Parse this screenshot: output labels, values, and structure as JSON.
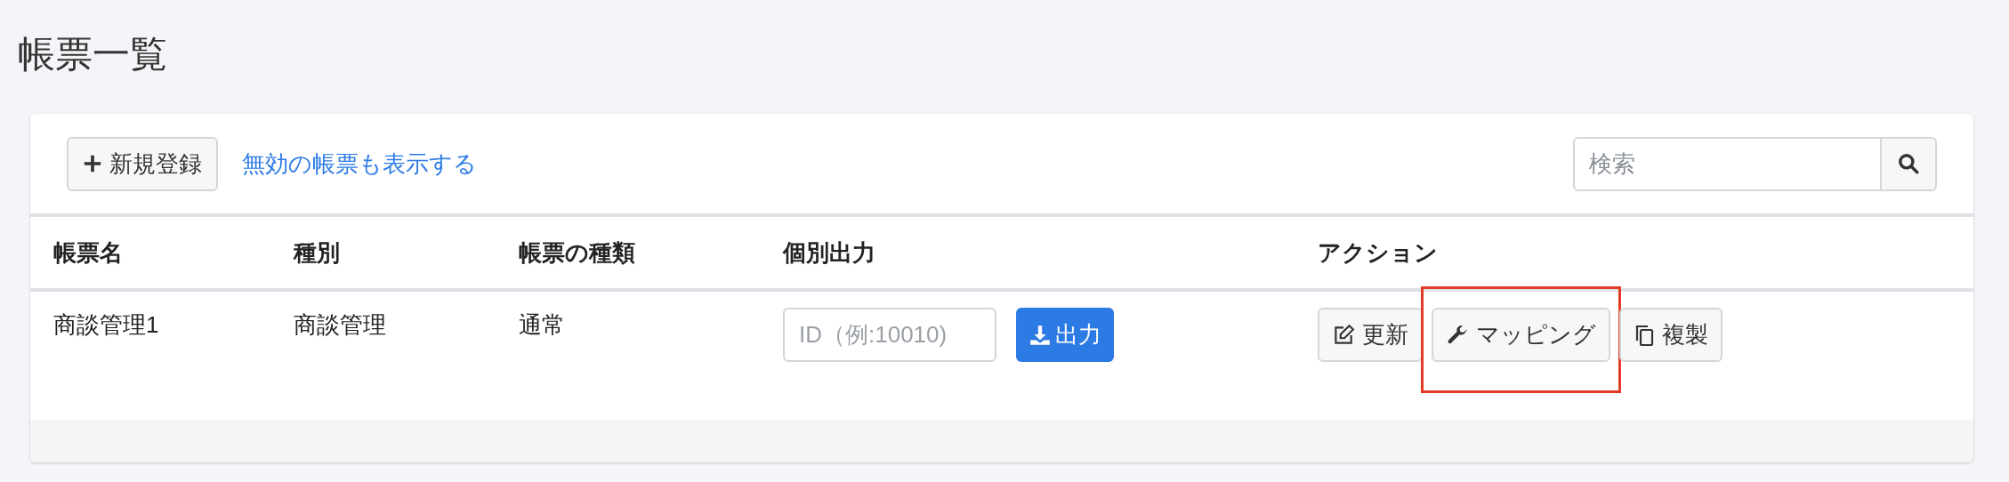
{
  "page_title": "帳票一覧",
  "toolbar": {
    "new_button": {
      "kind": "plus",
      "label": "新規登録"
    },
    "link": "無効の帳票も表示する",
    "search": {
      "placeholder": "検索"
    }
  },
  "table": {
    "columns": [
      "帳票名",
      "種別",
      "帳票の種類",
      "個別出力",
      "アクション"
    ],
    "rows": [
      {
        "name": "商談管理1",
        "type": "商談管理",
        "kind_of_form": "通常",
        "output": {
          "placeholder": "ID（例:10010)",
          "button": "出力"
        },
        "actions": [
          {
            "kind": "edit",
            "label": "更新",
            "highlighted": false
          },
          {
            "kind": "wrench",
            "label": "マッピング",
            "highlighted": true
          },
          {
            "kind": "copy",
            "label": "複製",
            "highlighted": false
          }
        ]
      }
    ]
  }
}
